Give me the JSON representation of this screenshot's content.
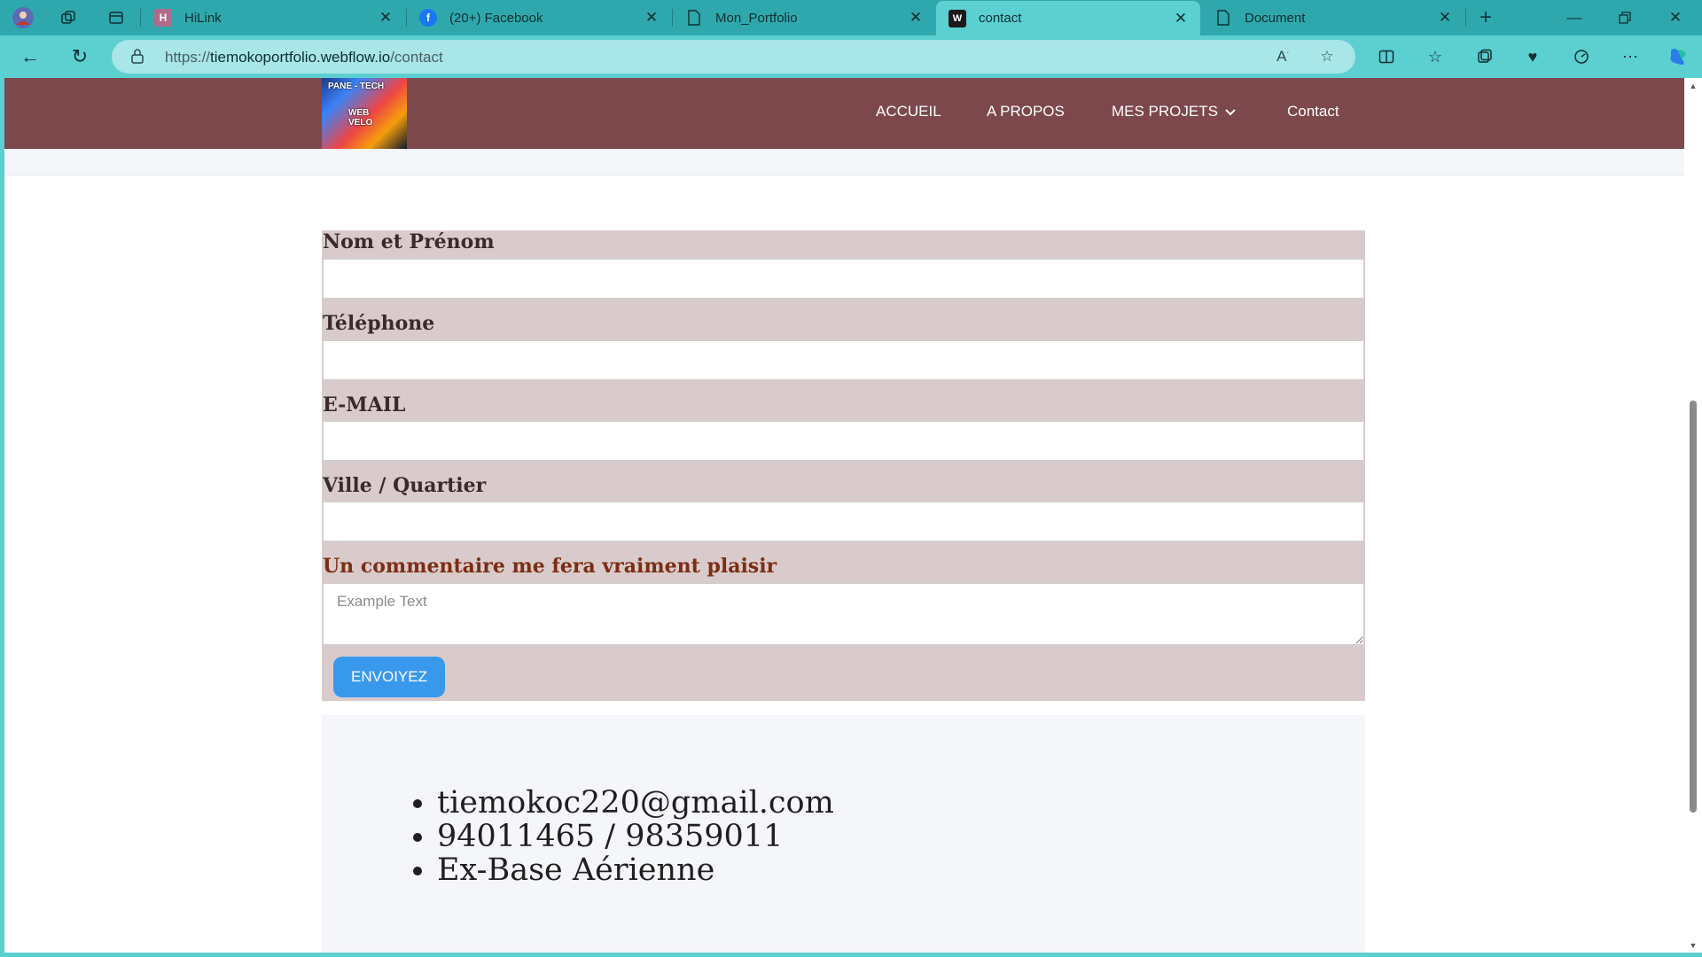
{
  "browser": {
    "tabs": [
      {
        "label": "HiLink",
        "icon": "hilink-icon",
        "active": false
      },
      {
        "label": "(20+) Facebook",
        "icon": "facebook-icon",
        "active": false
      },
      {
        "label": "Mon_Portfolio",
        "icon": "document-icon",
        "active": false
      },
      {
        "label": "contact",
        "icon": "webflow-icon",
        "active": true
      },
      {
        "label": "Document",
        "icon": "document-icon",
        "active": false
      }
    ],
    "url": {
      "prefix": "https://",
      "host": "tiemokoportfolio.webflow.io",
      "path": "/contact"
    }
  },
  "site": {
    "logo": {
      "line1": "PANE - TECH",
      "line2": "WEB VELO"
    },
    "nav": [
      {
        "label": "ACCUEIL"
      },
      {
        "label": "A PROPOS"
      },
      {
        "label": "MES PROJETS"
      },
      {
        "label": "Contact"
      }
    ]
  },
  "form": {
    "fields": [
      {
        "label": "Nom et Prénom",
        "value": ""
      },
      {
        "label": "Téléphone",
        "value": ""
      },
      {
        "label": "E-MAIL",
        "value": ""
      },
      {
        "label": "Ville / Quartier",
        "value": ""
      }
    ],
    "comment": {
      "label": "Un commentaire me fera vraiment plaisir",
      "placeholder": "Example Text"
    },
    "submit_label": "ENVOIYEZ"
  },
  "contact_info": [
    "tiemokoc220@gmail.com",
    "94011465 / 98359011",
    "Ex-Base Aérienne"
  ],
  "colors": {
    "browser_frame": "#5ccfd1",
    "tabstrip": "#2fa8ad",
    "nav_bg": "#7c484c",
    "form_bg": "#d9cbcc",
    "button": "#3898ec",
    "accent_label": "#7c2d12"
  }
}
